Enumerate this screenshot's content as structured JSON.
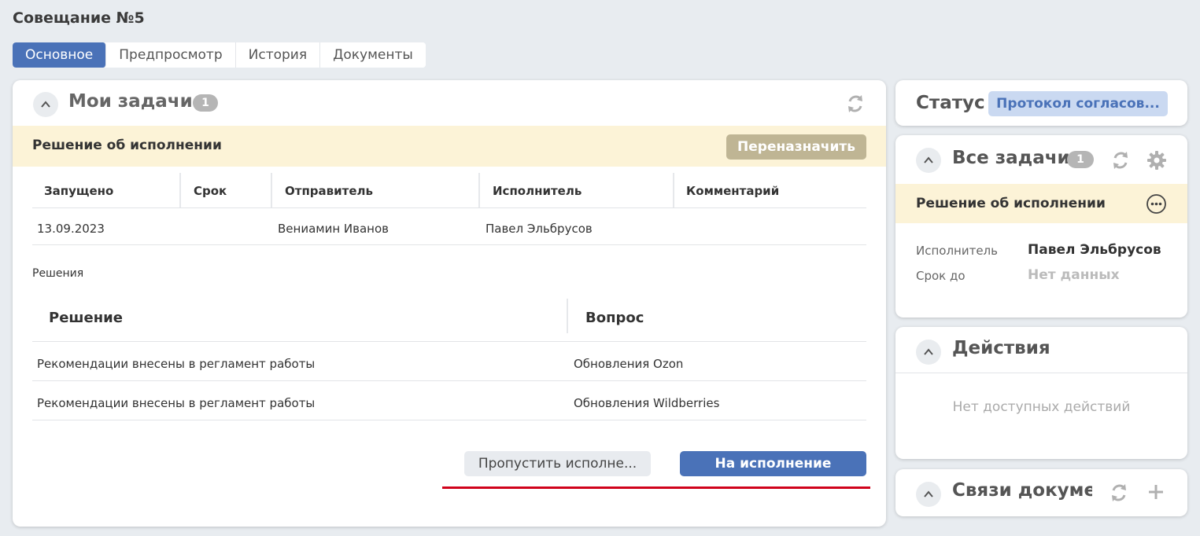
{
  "page": {
    "title": "Совещание №5"
  },
  "tabs": [
    {
      "label": "Основное",
      "active": true
    },
    {
      "label": "Предпросмотр",
      "active": false
    },
    {
      "label": "История",
      "active": false
    },
    {
      "label": "Документы",
      "active": false
    }
  ],
  "my_tasks": {
    "title": "Мои задачи",
    "count": "1",
    "task": {
      "title": "Решение об исполнении",
      "reassign_label": "Переназначить",
      "columns": [
        "Запущено",
        "Срок",
        "Отправитель",
        "Исполнитель",
        "Комментарий"
      ],
      "row": {
        "started": "13.09.2023",
        "deadline": "",
        "sender": "Вениамин Иванов",
        "executor": "Павел Эльбрусов",
        "comment": ""
      },
      "decisions_label": "Решения",
      "decisions_columns": [
        "Решение",
        "Вопрос"
      ],
      "decisions": [
        {
          "decision": "Рекомендации внесены в регламент работы",
          "question": "Обновления Ozon"
        },
        {
          "decision": "Рекомендации внесены в регламент работы",
          "question": "Обновления Wildberries"
        }
      ],
      "skip_label": "Пропустить исполне...",
      "execute_label": "На исполнение"
    }
  },
  "status": {
    "label": "Статус",
    "value": "Протокол согласов..."
  },
  "all_tasks": {
    "title": "Все задачи",
    "count": "1",
    "task_title": "Решение об исполнении",
    "executor_label": "Исполнитель",
    "executor_value": "Павел Эльбрусов",
    "deadline_label": "Срок до",
    "deadline_value": "Нет данных"
  },
  "actions": {
    "title": "Действия",
    "empty": "Нет доступных действий"
  },
  "links": {
    "title": "Связи докумен"
  },
  "colors": {
    "accent": "#4a72b8",
    "banner": "#fcf3d7",
    "underline": "#d0021b"
  },
  "icons": [
    "chevron-up-icon",
    "refresh-icon",
    "gear-icon",
    "more-icon",
    "plus-icon"
  ]
}
